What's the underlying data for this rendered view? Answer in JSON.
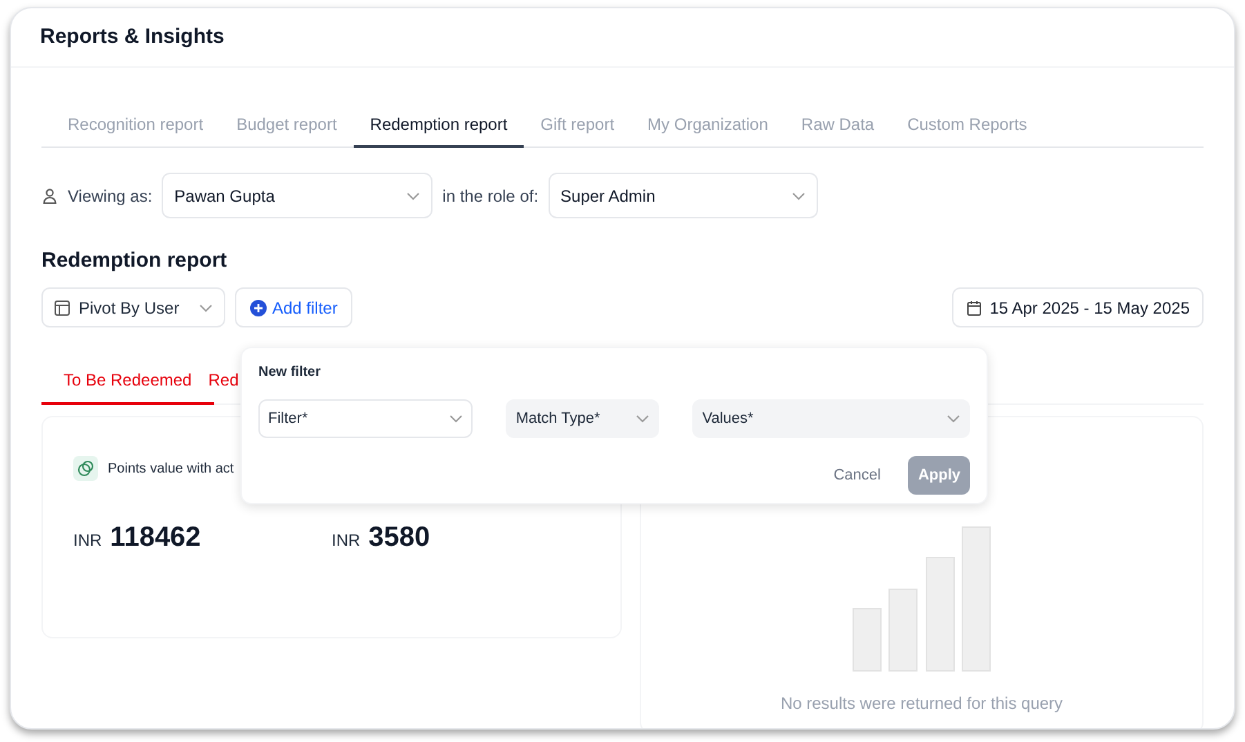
{
  "header": {
    "title": "Reports & Insights"
  },
  "tabs": [
    {
      "label": "Recognition report",
      "selected": false
    },
    {
      "label": "Budget report",
      "selected": false
    },
    {
      "label": "Redemption report",
      "selected": true
    },
    {
      "label": "Gift report",
      "selected": false
    },
    {
      "label": "My Organization",
      "selected": false
    },
    {
      "label": "Raw Data",
      "selected": false
    },
    {
      "label": "Custom Reports",
      "selected": false
    }
  ],
  "viewing": {
    "label": "Viewing as:",
    "user": "Pawan Gupta",
    "role_label": "in the role of:",
    "role": "Super Admin"
  },
  "section_title": "Redemption report",
  "toolbar": {
    "pivot": "Pivot By User",
    "add_filter": "Add filter",
    "date_range": "15 Apr 2025 - 15 May 2025"
  },
  "sub_tabs": [
    {
      "label": "To Be Redeemed",
      "selected": true
    },
    {
      "label": "Red",
      "selected": false
    }
  ],
  "summary_card": {
    "label": "Points value with act",
    "amounts": [
      {
        "currency": "INR",
        "value": "118462"
      },
      {
        "currency": "INR",
        "value": "3580"
      }
    ]
  },
  "empty_state": {
    "message": "No results were returned for this query"
  },
  "filter_popover": {
    "title": "New filter",
    "fields": [
      {
        "placeholder": "Filter*",
        "disabled": false
      },
      {
        "placeholder": "Match Type*",
        "disabled": true
      },
      {
        "placeholder": "Values*",
        "disabled": true
      }
    ],
    "cancel": "Cancel",
    "apply": {
      "label": "Apply",
      "disabled": true
    }
  }
}
